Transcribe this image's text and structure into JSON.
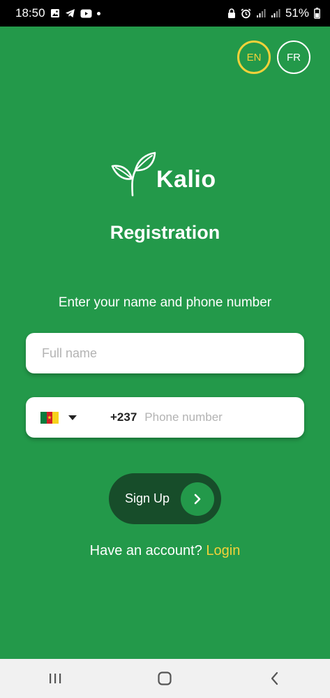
{
  "status_bar": {
    "time": "18:50",
    "battery": "51%",
    "left_icons": [
      "gallery-icon",
      "telegram-icon",
      "youtube-icon",
      "notification-dot-icon"
    ],
    "right_icons": [
      "lock-icon",
      "alarm-icon",
      "signal-icon",
      "signal-icon"
    ]
  },
  "language": {
    "en_label": "EN",
    "fr_label": "FR",
    "selected": "EN",
    "selected_color": "#f2d13a"
  },
  "logo": {
    "text": "Kalio",
    "icon": "leaf-icon"
  },
  "title": "Registration",
  "instruction": "Enter your name and phone number",
  "form": {
    "name_placeholder": "Full name",
    "name_value": "",
    "country_flag": "cameroon-flag",
    "dial_code": "+237",
    "phone_placeholder": "Phone number",
    "phone_value": ""
  },
  "signup": {
    "label": "Sign Up",
    "icon": "chevron-right-icon"
  },
  "login": {
    "prompt": "Have an account?",
    "link": "Login"
  },
  "nav": [
    "recent-apps-icon",
    "home-icon",
    "back-icon"
  ],
  "colors": {
    "background": "#23994a",
    "button_dark": "#174d2a",
    "accent_yellow": "#f2d13a"
  }
}
